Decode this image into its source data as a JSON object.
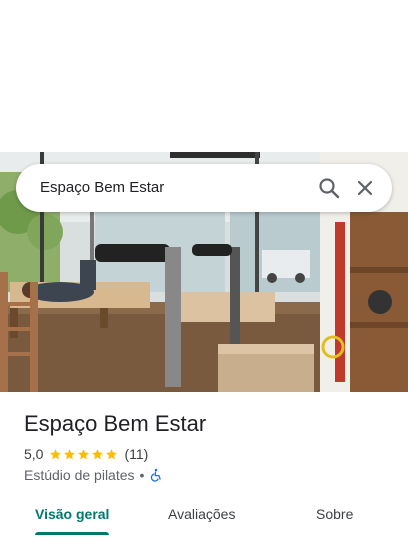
{
  "search": {
    "query": "Espaço Bem Estar",
    "search_icon": "search-icon",
    "close_icon": "close-icon"
  },
  "place": {
    "title": "Espaço Bem Estar",
    "rating": "5,0",
    "star_count": 5,
    "reviews": "(11)",
    "category": "Estúdio de pilates",
    "separator": "•",
    "accessibility_icon": "wheelchair-icon"
  },
  "tabs": [
    {
      "label": "Visão geral",
      "active": true
    },
    {
      "label": "Avaliações",
      "active": false
    },
    {
      "label": "Sobre",
      "active": false
    }
  ],
  "colors": {
    "accent": "#00796b",
    "star": "#fbbc04",
    "accessibility": "#1a73e8"
  }
}
